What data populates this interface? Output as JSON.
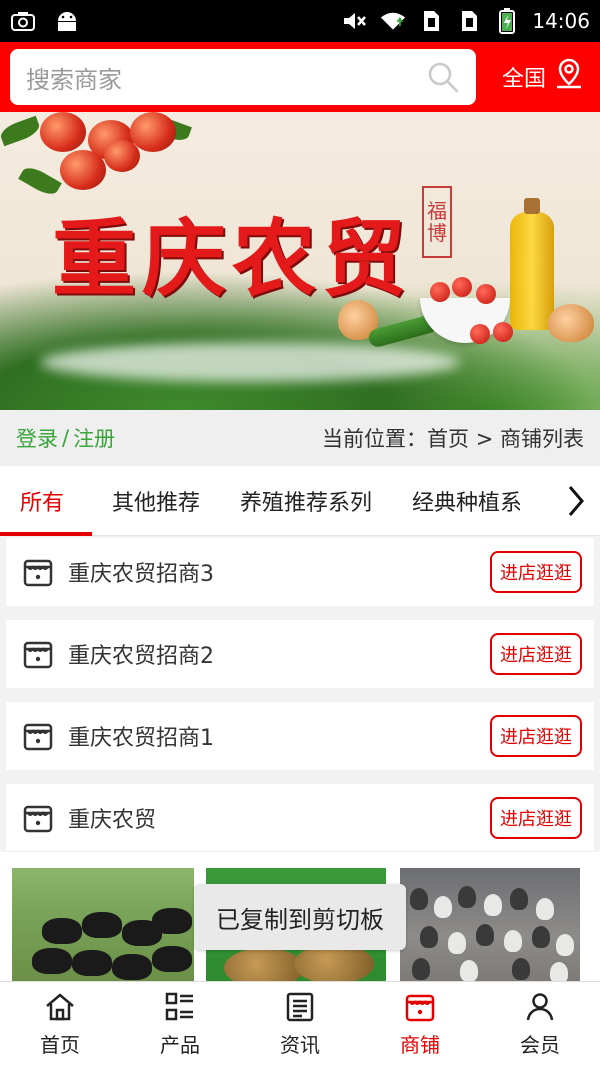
{
  "status_bar": {
    "time": "14:06",
    "left_icons": [
      "screenshot-icon",
      "android-icon"
    ],
    "right_icons": [
      "mute-icon",
      "wifi-icon",
      "sim1-icon",
      "sim2-icon",
      "battery-icon"
    ]
  },
  "header": {
    "search_placeholder": "搜索商家",
    "region_label": "全国"
  },
  "banner": {
    "title": "重庆农贸",
    "seal_text": [
      "福",
      "博"
    ]
  },
  "info_bar": {
    "login_label": "登录",
    "separator": "/",
    "register_label": "注册",
    "breadcrumb": "当前位置：首页 > 商铺列表"
  },
  "tabs": [
    {
      "label": "所有",
      "active": true
    },
    {
      "label": "其他推荐",
      "active": false
    },
    {
      "label": "养殖推荐系列",
      "active": false
    },
    {
      "label": "经典种植系",
      "active": false
    }
  ],
  "stores": [
    {
      "name": "重庆农贸招商3",
      "button": "进店逛逛"
    },
    {
      "name": "重庆农贸招商2",
      "button": "进店逛逛"
    },
    {
      "name": "重庆农贸招商1",
      "button": "进店逛逛"
    },
    {
      "name": "重庆农贸",
      "button": "进店逛逛"
    }
  ],
  "toast": "已复制到剪切板",
  "bottom_nav": [
    {
      "label": "首页",
      "icon": "home-icon",
      "active": false
    },
    {
      "label": "产品",
      "icon": "grid-list-icon",
      "active": false
    },
    {
      "label": "资讯",
      "icon": "news-icon",
      "active": false
    },
    {
      "label": "商铺",
      "icon": "shop-icon",
      "active": true
    },
    {
      "label": "会员",
      "icon": "user-icon",
      "active": false
    }
  ],
  "colors": {
    "brand_red": "#e40000",
    "header_red": "#ff0000",
    "login_green": "#3aa53a"
  }
}
